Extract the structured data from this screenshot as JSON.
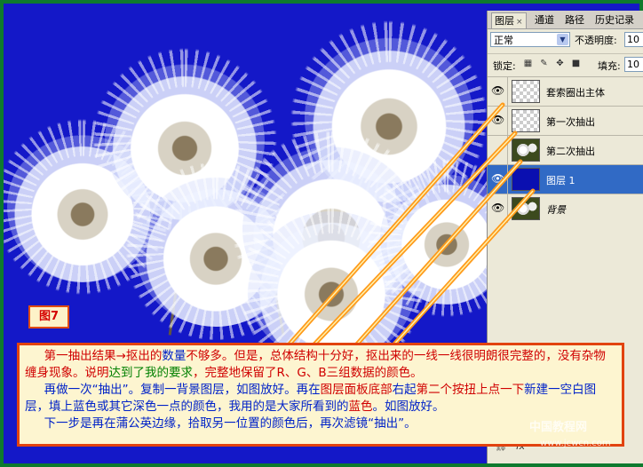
{
  "colors": {
    "border": "#0e7a2e",
    "background": "#1418c8",
    "note_border": "#e2430f",
    "note_bg": "#fdf5d0",
    "selected_layer": "#316ac5"
  },
  "panel": {
    "tabs": [
      {
        "label": "图层",
        "close": "×",
        "active": true
      },
      {
        "label": "通道",
        "active": false
      },
      {
        "label": "路径",
        "active": false
      },
      {
        "label": "历史记录",
        "active": false
      }
    ],
    "blend_mode": "正常",
    "opacity_label": "不透明度:",
    "opacity_value": "10",
    "lock_label": "锁定:",
    "fill_label": "填充:",
    "fill_value": "10",
    "layers": [
      {
        "name": "套索圈出主体",
        "thumb": "transparent",
        "visible": true,
        "selected": false
      },
      {
        "name": "第一次抽出",
        "thumb": "transparent",
        "visible": true,
        "selected": false
      },
      {
        "name": "第二次抽出",
        "thumb": "photo",
        "visible": false,
        "selected": false
      },
      {
        "name": "图层 1",
        "thumb": "blue",
        "visible": true,
        "selected": true
      },
      {
        "name": "背景",
        "thumb": "photo",
        "visible": true,
        "selected": false,
        "italic": true
      }
    ],
    "eye_icon": "👁",
    "bottom_icons": [
      "link-icon",
      "fx-icon"
    ]
  },
  "figure_label": "图7",
  "note": {
    "p1": [
      {
        "t": "第一抽出结果→抠出的",
        "c": "red"
      },
      {
        "t": "数量",
        "c": "blu"
      },
      {
        "t": "不够多。但是，总体结构十分好，抠出来的一线一线很明朗很完整的，没有杂物缠身现象。说明",
        "c": "red"
      },
      {
        "t": "达到了我的要求",
        "c": "grn"
      },
      {
        "t": "，完整地保留了R、G、B三组数据的颜色。",
        "c": "red"
      }
    ],
    "p2": [
      {
        "t": "再做一次“抽出”。复制一背景图层，如图放好。再在",
        "c": "blu"
      },
      {
        "t": "图层面板底部",
        "c": "red"
      },
      {
        "t": "右起",
        "c": "blu"
      },
      {
        "t": "第二个按扭上点一下",
        "c": "red"
      },
      {
        "t": "新建一空白图层，填上蓝色或其它深色一点的颜色，我用的是大家所看到的",
        "c": "blu"
      },
      {
        "t": "蓝色",
        "c": "red"
      },
      {
        "t": "。如图放好。",
        "c": "blu"
      }
    ],
    "p3": [
      {
        "t": "下一步是再在蒲公英边缘，拾取另一位置的颜色后，再次滤镜“抽出”。",
        "c": "blu"
      }
    ]
  },
  "watermark": {
    "line1": "中国教程网",
    "line2": "www.jcwcn.com"
  }
}
